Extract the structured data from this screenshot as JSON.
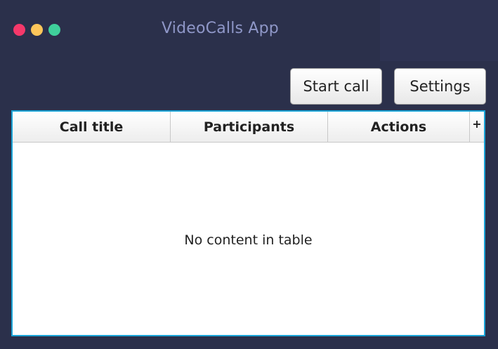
{
  "window": {
    "title": "VideoCalls App",
    "controls": {
      "close_color": "#f5386a",
      "minimize_color": "#fec65a",
      "maximize_color": "#3fd09b"
    }
  },
  "toolbar": {
    "start_call_label": "Start call",
    "settings_label": "Settings"
  },
  "table": {
    "columns": [
      "Call title",
      "Participants",
      "Actions"
    ],
    "column_menu_icon": "plus-icon",
    "column_menu_glyph": "+",
    "rows": [],
    "empty_message": "No content in table"
  },
  "colors": {
    "background": "#2b304b",
    "accent": "#1aa3d6"
  }
}
